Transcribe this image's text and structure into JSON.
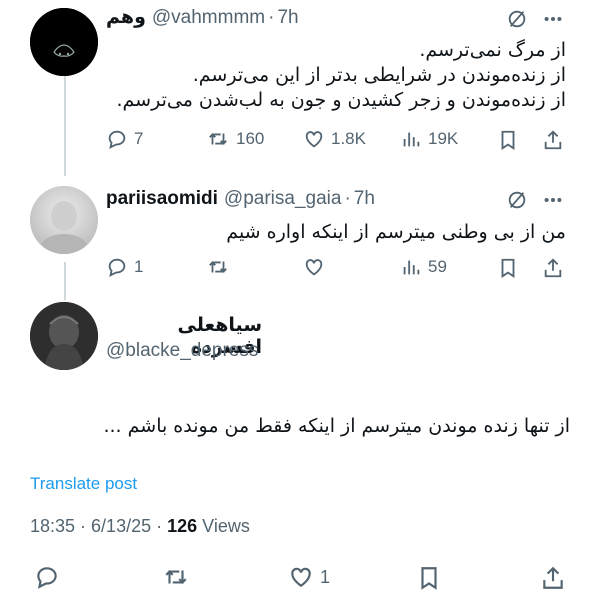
{
  "tweets": [
    {
      "name": "وهم",
      "handle": "@vahmmmm",
      "time": "7h",
      "lines": [
        "از مرگ نمی‌ترسم.",
        "از زنده‌موندن در شرایطی بدتر از این می‌ترسم.",
        "از زنده‌موندن و زجر کشیدن و جون به لب‌شدن می‌ترسم."
      ],
      "replies": "7",
      "reposts": "160",
      "likes": "1.8K",
      "views": "19K"
    },
    {
      "name": "pariisaomidi",
      "handle": "@parisa_gaia",
      "time": "7h",
      "lines": [
        "من از بی وطنی میترسم از اینکه اواره شیم"
      ],
      "replies": "1",
      "reposts": "",
      "likes": "",
      "views": "59"
    }
  ],
  "main": {
    "name": "سیاهعلی افسرده",
    "handle": "@blacke_depress",
    "text": "از تنها زنده موندن میترسم از اینکه فقط من مونده باشم ...",
    "translate": "Translate post",
    "timestamp": "18:35 · 6/13/25 · ",
    "views_count": "126",
    "views_label": " Views",
    "likes": "1"
  },
  "separator": "·",
  "icons": [
    "grok-icon",
    "more-icon",
    "reply-icon",
    "repost-icon",
    "like-icon",
    "views-icon",
    "bookmark-icon",
    "share-icon"
  ],
  "colors": {
    "text": "#0f1419",
    "muted": "#536471",
    "link": "#1d9bf0",
    "line": "#cfd9de"
  }
}
